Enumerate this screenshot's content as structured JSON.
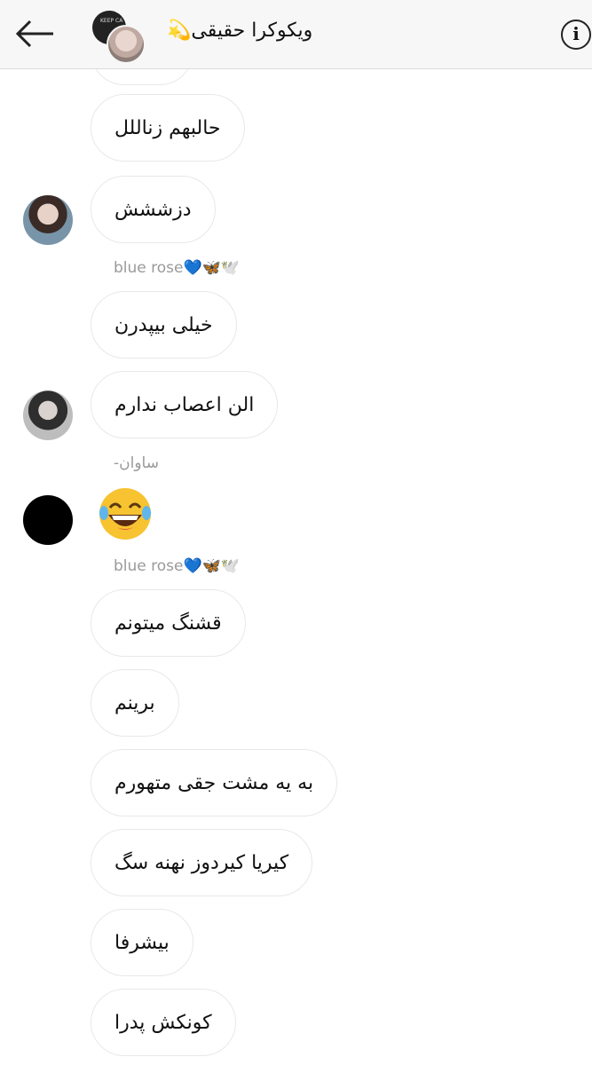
{
  "header": {
    "title": "ویکوکرا حقیقی💫",
    "avatar_text": "KEEP CA"
  },
  "messages": [
    {
      "text": "حالبهم زناللل"
    },
    {
      "text": "دزششش"
    },
    {
      "sender": "blue rose💙🦋🕊️"
    },
    {
      "text": "خیلی بیپدرن"
    },
    {
      "text": "الن اعصاب ندارم"
    },
    {
      "sender": "ساوان-"
    },
    {
      "emoji": "joy"
    },
    {
      "sender": "blue rose💙🦋🕊️"
    },
    {
      "text": "قشنگ میتونم"
    },
    {
      "text": "برینم"
    },
    {
      "text": "به یه مشت جقی متهورم"
    },
    {
      "text": "کیریا کیردوز نهنه سگ"
    },
    {
      "text": "بیشرفا"
    },
    {
      "text": "کونکش پدرا"
    }
  ],
  "colors": {
    "header_bg": "#f7f7f7",
    "bubble_border": "#e8e8e8",
    "sender_text": "#9a9a9a"
  },
  "icons": [
    "back-arrow-icon",
    "info-icon",
    "laughing-emoji-icon"
  ]
}
